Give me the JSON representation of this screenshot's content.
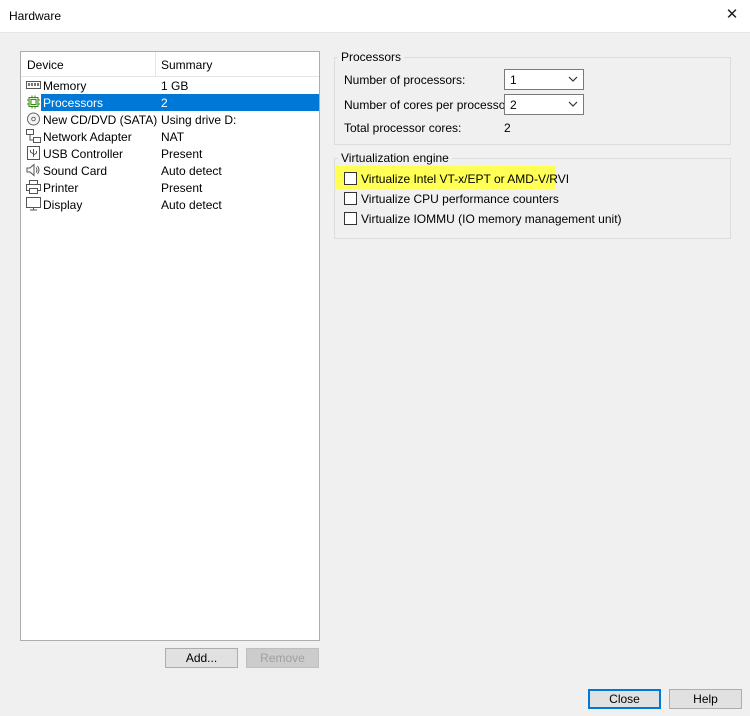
{
  "window": {
    "title": "Hardware"
  },
  "device_list": {
    "headers": {
      "device": "Device",
      "summary": "Summary"
    },
    "items": [
      {
        "name": "Memory",
        "summary": "1 GB",
        "icon": "memory-icon",
        "selected": false
      },
      {
        "name": "Processors",
        "summary": "2",
        "icon": "processor-icon",
        "selected": true
      },
      {
        "name": "New CD/DVD (SATA)",
        "summary": "Using drive D:",
        "icon": "cd-dvd-icon",
        "selected": false
      },
      {
        "name": "Network Adapter",
        "summary": "NAT",
        "icon": "network-adapter-icon",
        "selected": false
      },
      {
        "name": "USB Controller",
        "summary": "Present",
        "icon": "usb-controller-icon",
        "selected": false
      },
      {
        "name": "Sound Card",
        "summary": "Auto detect",
        "icon": "sound-card-icon",
        "selected": false
      },
      {
        "name": "Printer",
        "summary": "Present",
        "icon": "printer-icon",
        "selected": false
      },
      {
        "name": "Display",
        "summary": "Auto detect",
        "icon": "display-icon",
        "selected": false
      }
    ],
    "add_label": "Add...",
    "remove_label": "Remove"
  },
  "processors": {
    "group_label": "Processors",
    "num_processors_label": "Number of processors:",
    "num_processors_value": "1",
    "cores_label": "Number of cores per processor:",
    "cores_value": "2",
    "total_label": "Total processor cores:",
    "total_value": "2"
  },
  "virtualization": {
    "group_label": "Virtualization engine",
    "options": [
      {
        "label": "Virtualize Intel VT-x/EPT or AMD-V/RVI",
        "checked": false,
        "highlighted": true
      },
      {
        "label": "Virtualize CPU performance counters",
        "checked": false,
        "highlighted": false
      },
      {
        "label": "Virtualize IOMMU (IO memory management unit)",
        "checked": false,
        "highlighted": false
      }
    ]
  },
  "footer": {
    "close_label": "Close",
    "help_label": "Help"
  },
  "colors": {
    "selection": "#0078d7",
    "highlight": "#ffff55",
    "dialog_bg": "#f0f0f0"
  }
}
